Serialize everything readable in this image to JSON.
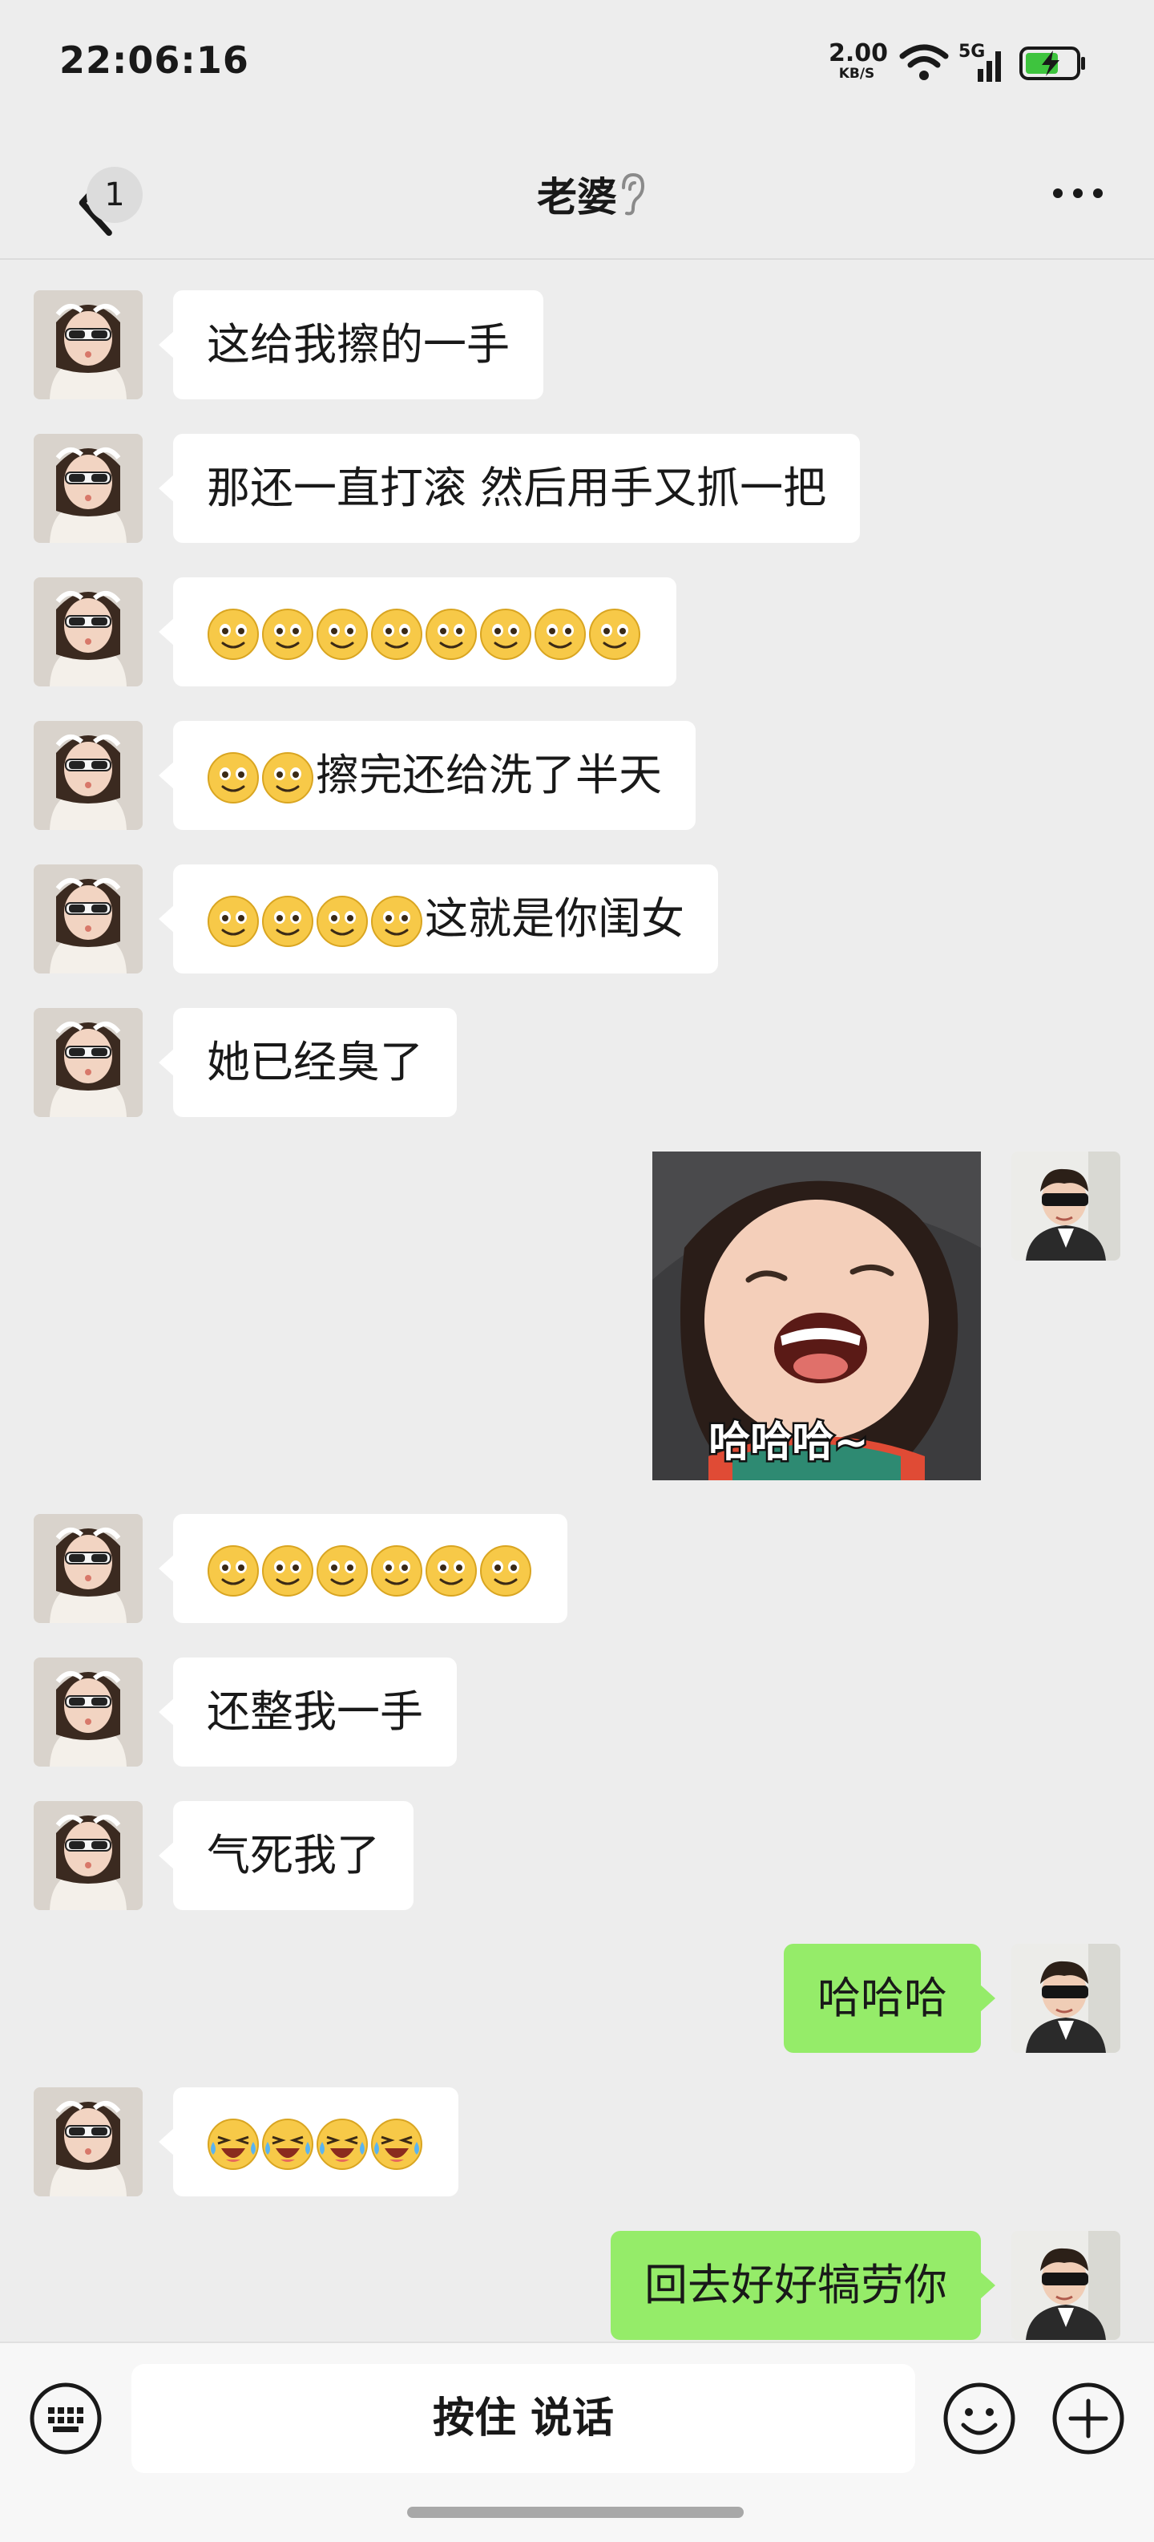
{
  "status_bar": {
    "time": "22:06:16",
    "net_speed_value": "2.00",
    "net_speed_unit": "KB/S",
    "network_label": "5G",
    "icons": [
      "wifi-icon",
      "cellular-signal-icon",
      "battery-charging-icon"
    ]
  },
  "nav": {
    "back_icon": "chevron-left-icon",
    "unread_count": "1",
    "title": "老婆",
    "ear_icon": "earpiece-mode-icon",
    "more_icon": "more-dots-icon"
  },
  "messages": [
    {
      "side": "in",
      "text": "这给我擦的一手"
    },
    {
      "side": "in",
      "text": "那还一直打滚 然后用手又抓一把"
    },
    {
      "side": "in",
      "emoji": "smile",
      "emoji_count": 8,
      "text": ""
    },
    {
      "side": "in",
      "emoji": "smile",
      "emoji_count": 2,
      "text": "擦完还给洗了半天"
    },
    {
      "side": "in",
      "emoji": "smile",
      "emoji_count": 4,
      "text": "这就是你闺女"
    },
    {
      "side": "in",
      "text": "她已经臭了"
    },
    {
      "side": "out",
      "type": "sticker",
      "sticker_caption": "哈哈哈~"
    },
    {
      "side": "in",
      "emoji": "smile",
      "emoji_count": 6,
      "text": ""
    },
    {
      "side": "in",
      "text": "还整我一手"
    },
    {
      "side": "in",
      "text": "气死我了"
    },
    {
      "side": "out",
      "text": "哈哈哈"
    },
    {
      "side": "in",
      "emoji": "laugh-cry",
      "emoji_count": 4,
      "text": ""
    },
    {
      "side": "out",
      "text": "回去好好犒劳你"
    }
  ],
  "input_bar": {
    "keyboard_icon": "keyboard-icon",
    "hold_to_talk_label": "按住 说话",
    "emoji_icon": "emoji-face-icon",
    "plus_icon": "plus-circle-icon"
  },
  "colors": {
    "background": "#ededed",
    "incoming_bubble": "#ffffff",
    "outgoing_bubble": "#95ec69",
    "text": "#191919"
  }
}
